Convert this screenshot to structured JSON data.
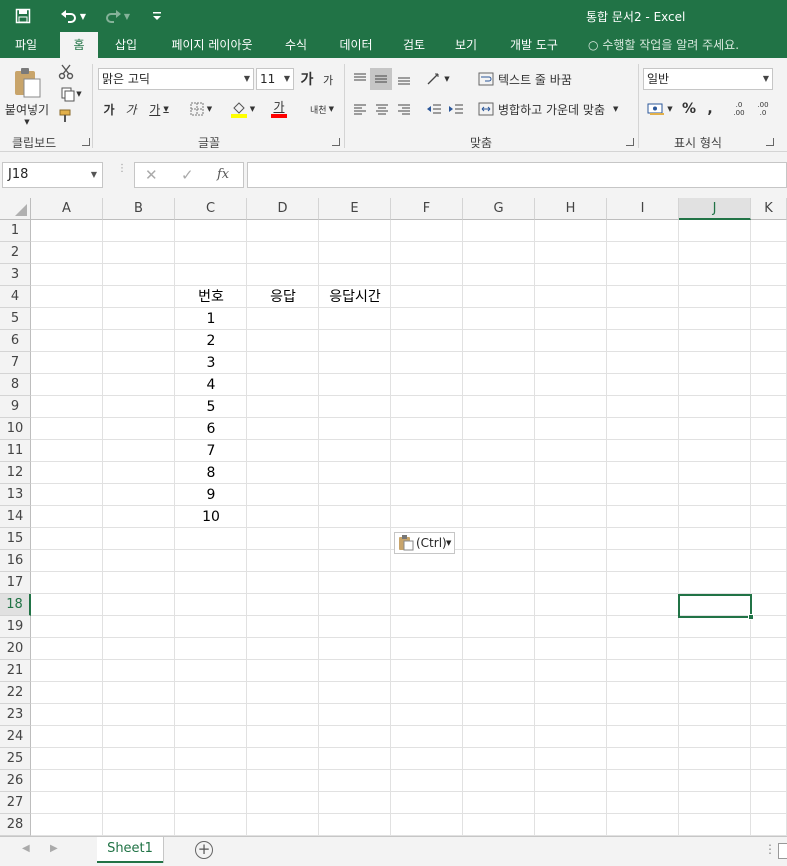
{
  "titlebar": {
    "title": "통합 문서2 - Excel"
  },
  "tabs": [
    {
      "label": "파일"
    },
    {
      "label": "홈"
    },
    {
      "label": "삽입"
    },
    {
      "label": "페이지 레이아웃"
    },
    {
      "label": "수식"
    },
    {
      "label": "데이터"
    },
    {
      "label": "검토"
    },
    {
      "label": "보기"
    },
    {
      "label": "개발 도구"
    }
  ],
  "tell_me": "수행할 작업을 알려 주세요.",
  "ribbon": {
    "clipboard": {
      "paste_label": "붙여넣기",
      "group_label": "클립보드"
    },
    "font": {
      "name": "맑은 고딕",
      "size": "11",
      "grow": "가",
      "shrink": "가",
      "bold": "가",
      "italic": "가",
      "underline": "가",
      "color_letter": "가",
      "phonetic": "내천",
      "group_label": "글꼴"
    },
    "alignment": {
      "wrap_text": "텍스트 줄 바꿈",
      "merge_center": "병합하고 가운데 맞춤",
      "group_label": "맞춤"
    },
    "number": {
      "format": "일반",
      "percent": "%",
      "comma": ",",
      "inc_decimal": ".0 .00",
      "dec_decimal": ".00 .0",
      "group_label": "표시 형식"
    }
  },
  "formula_bar": {
    "name_box": "J18",
    "fx": "fx",
    "value": ""
  },
  "columns": [
    "A",
    "B",
    "C",
    "D",
    "E",
    "F",
    "G",
    "H",
    "I",
    "J",
    "K"
  ],
  "selected_column": "J",
  "rows": [
    "1",
    "2",
    "3",
    "4",
    "5",
    "6",
    "7",
    "8",
    "9",
    "10",
    "11",
    "12",
    "13",
    "14",
    "15",
    "16",
    "17",
    "18",
    "19",
    "20",
    "21",
    "22",
    "23",
    "24",
    "25",
    "26",
    "27",
    "28"
  ],
  "selected_row": "18",
  "cells": {
    "header": {
      "C4": "번호",
      "D4": "응답",
      "E4": "응답시간"
    },
    "numbers": [
      "1",
      "2",
      "3",
      "4",
      "5",
      "6",
      "7",
      "8",
      "9",
      "10"
    ]
  },
  "paste_options": "(Ctrl)",
  "sheet": {
    "name": "Sheet1"
  },
  "colors": {
    "accent": "#217346",
    "ribbon_bg": "#f3f3f3",
    "grid_line": "#e1e1e1"
  }
}
